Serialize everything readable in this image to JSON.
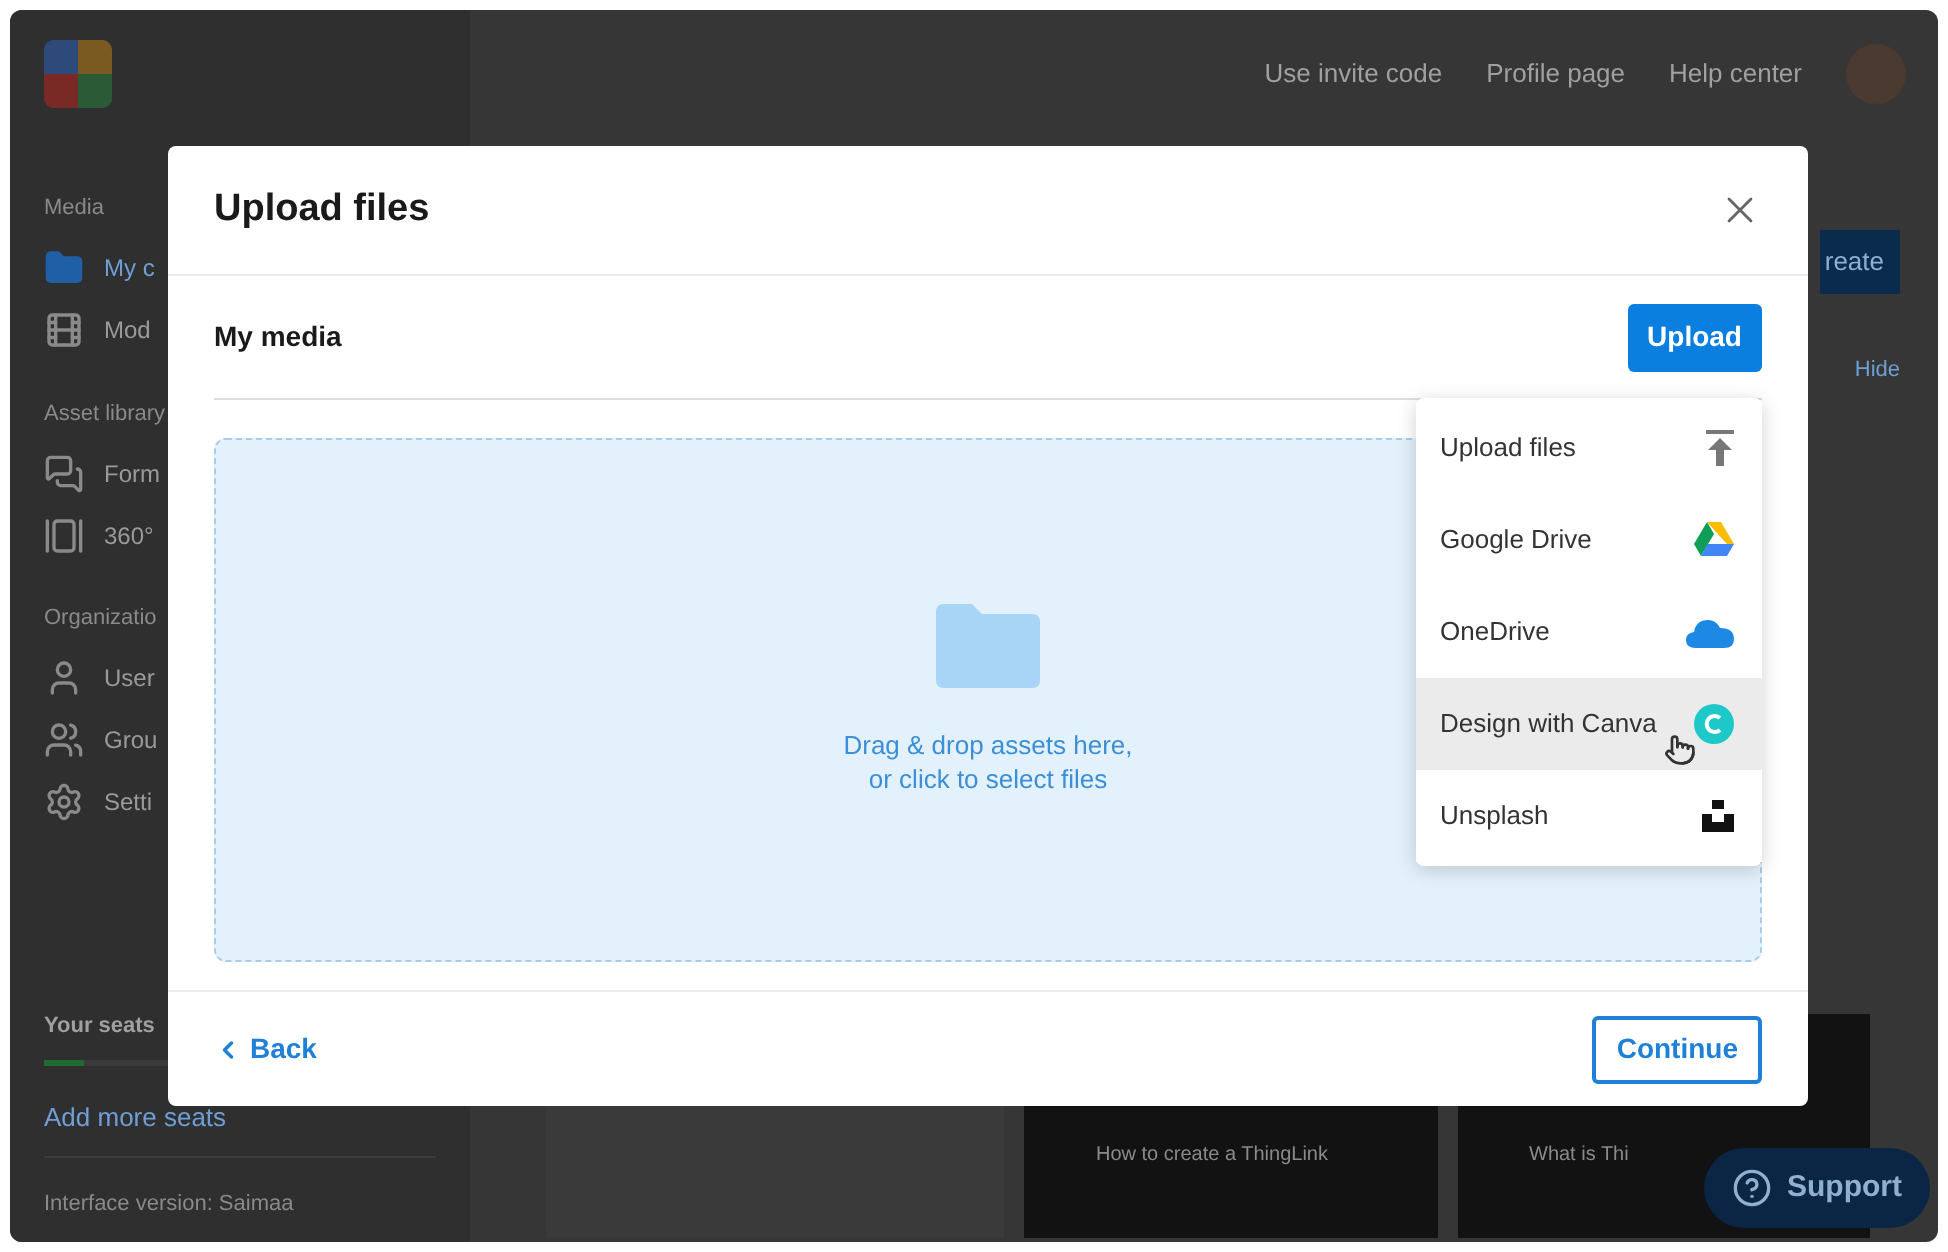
{
  "header": {
    "links": [
      "Use invite code",
      "Profile page",
      "Help center"
    ]
  },
  "sidebar": {
    "sections": [
      {
        "label": "Media",
        "items": [
          {
            "label": "My c",
            "selected": true
          },
          {
            "label": "Mod",
            "selected": false
          }
        ]
      },
      {
        "label": "Asset library",
        "items": [
          {
            "label": "Form",
            "selected": false
          },
          {
            "label": "360°",
            "selected": false
          }
        ]
      },
      {
        "label": "Organizatio",
        "items": [
          {
            "label": "User",
            "selected": false
          },
          {
            "label": "Grou",
            "selected": false
          },
          {
            "label": "Setti",
            "selected": false
          }
        ]
      }
    ],
    "seats": {
      "title": "Your seats",
      "level": 0.1,
      "link": "Add more seats"
    },
    "version": "Interface version: Saimaa"
  },
  "create_button": "reate",
  "hide_link": "Hide",
  "cards": [
    {
      "kind": "illustration"
    },
    {
      "kind": "video",
      "caption": "How to create a ThingLink"
    },
    {
      "kind": "video",
      "caption": "What is Thi"
    }
  ],
  "support_button": "Support",
  "modal": {
    "title": "Upload files",
    "section": "My media",
    "upload_button": "Upload",
    "menu": [
      {
        "label": "Upload files",
        "highlighted": false
      },
      {
        "label": "Google Drive",
        "highlighted": false
      },
      {
        "label": "OneDrive",
        "highlighted": false
      },
      {
        "label": "Design with Canva",
        "highlighted": true
      },
      {
        "label": "Unsplash",
        "highlighted": false
      }
    ],
    "dropzone": {
      "line1": "Drag & drop assets here,",
      "line2": "or click to select files"
    },
    "back": "Back",
    "continue": "Continue"
  }
}
